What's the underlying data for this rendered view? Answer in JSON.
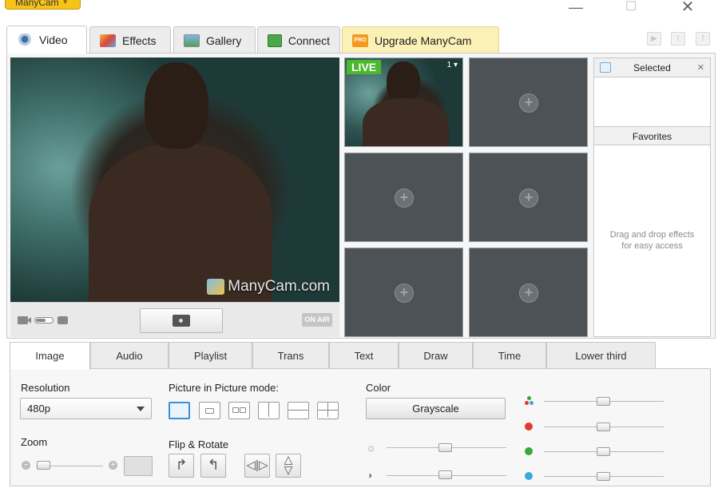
{
  "app": {
    "name": "ManyCam"
  },
  "window": {
    "minimize": "—",
    "maximize": "☐",
    "close": "✕"
  },
  "top_tabs": [
    {
      "label": "Video",
      "icon": "webcam-icon",
      "active": true
    },
    {
      "label": "Effects",
      "icon": "effects-icon"
    },
    {
      "label": "Gallery",
      "icon": "gallery-icon"
    },
    {
      "label": "Connect",
      "icon": "connect-icon"
    },
    {
      "label": "Upgrade ManyCam",
      "icon": "pro-badge-icon",
      "badge": "PRO"
    }
  ],
  "social": [
    "youtube-icon",
    "twitter-icon",
    "facebook-icon"
  ],
  "preview": {
    "watermark": "ManyCam.com",
    "on_air": "ON AIR"
  },
  "sources": {
    "live_label": "LIVE",
    "live_index": "1"
  },
  "side": {
    "selected_title": "Selected",
    "favorites_title": "Favorites",
    "drag_hint_1": "Drag and drop effects",
    "drag_hint_2": "for easy access"
  },
  "bottom_tabs": [
    "Image",
    "Audio",
    "Playlist",
    "Trans",
    "Text",
    "Draw",
    "Time",
    "Lower third"
  ],
  "image_panel": {
    "resolution_label": "Resolution",
    "resolution_value": "480p",
    "zoom_label": "Zoom",
    "pip_label": "Picture in Picture mode:",
    "flip_label": "Flip & Rotate",
    "color_label": "Color",
    "grayscale_button": "Grayscale"
  },
  "colors": {
    "live_green": "#4cb82e",
    "accent_blue": "#3b8fd8",
    "red": "#e03b2f",
    "green": "#39a83a",
    "blue": "#3aa9d8"
  }
}
